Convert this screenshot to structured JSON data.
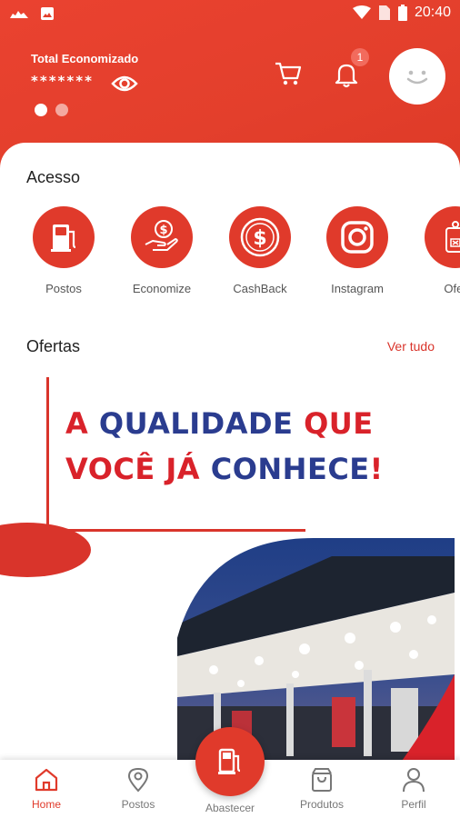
{
  "status_bar": {
    "time": "20:40",
    "icons": [
      "app-notification-icon",
      "image-notification-icon",
      "wifi-icon",
      "sim-icon",
      "battery-icon"
    ]
  },
  "header": {
    "total_label": "Total Economizado",
    "hidden_value": "*******",
    "notification_count": "1",
    "carousel_dots": 2,
    "carousel_active": 0
  },
  "acesso": {
    "title": "Acesso",
    "items": [
      {
        "label": "Postos",
        "icon": "fuel-pump-icon"
      },
      {
        "label": "Economize",
        "icon": "hand-money-icon"
      },
      {
        "label": "CashBack",
        "icon": "dollar-coin-icon"
      },
      {
        "label": "Instagram",
        "icon": "instagram-icon"
      },
      {
        "label": "Ofer",
        "icon": "tag-icon"
      }
    ]
  },
  "ofertas": {
    "title": "Ofertas",
    "see_all": "Ver tudo",
    "banner": {
      "line1": [
        {
          "text": "A ",
          "color": "red"
        },
        {
          "text": "QUALIDADE ",
          "color": "blue"
        },
        {
          "text": "QUE",
          "color": "red"
        }
      ],
      "line2": [
        {
          "text": "VOCÊ JÁ ",
          "color": "red"
        },
        {
          "text": "CONHECE",
          "color": "blue"
        },
        {
          "text": "!",
          "color": "red"
        }
      ]
    }
  },
  "bottom_nav": {
    "items": [
      {
        "label": "Home",
        "icon": "home-icon",
        "active": true
      },
      {
        "label": "Postos",
        "icon": "location-pin-icon",
        "active": false
      },
      {
        "label": "Abastecer",
        "icon": "fuel-pump-icon",
        "active": false
      },
      {
        "label": "Produtos",
        "icon": "shopping-bag-icon",
        "active": false
      },
      {
        "label": "Perfil",
        "icon": "person-icon",
        "active": false
      }
    ]
  },
  "colors": {
    "primary": "#e03a2b",
    "banner_red": "#d9222a",
    "banner_blue": "#2a3c8f"
  }
}
